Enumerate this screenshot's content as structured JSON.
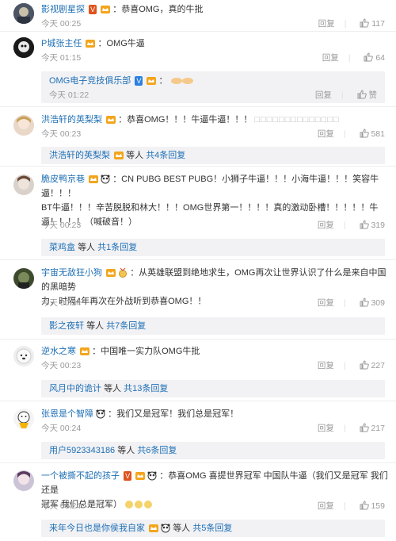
{
  "comments": [
    {
      "user": "影视剧星探",
      "text": "：恭喜OMG，真的牛批",
      "time": "今天 00:25",
      "reply_label": "回复",
      "likes": "117"
    },
    {
      "user": "P城张主任",
      "text": "：OMG牛逼",
      "time": "今天 01:15",
      "reply_label": "回复",
      "likes": "64",
      "sub_reply": {
        "user": "OMG电子竞技俱乐部",
        "text": "：",
        "time": "今天 01:22",
        "reply_label": "回复",
        "like_label": "赞"
      }
    },
    {
      "user": "洪浩轩的英梨梨",
      "text": "：恭喜OMG！！！牛逼牛逼！！！",
      "time": "今天 00:23",
      "reply_label": "回复",
      "likes": "581",
      "summary_user": "洪浩轩的英梨梨",
      "summary_mid": "等人",
      "summary_count": "共4条回复"
    },
    {
      "user": "脆皮鸭京巷",
      "text_lines": [
        "：CN PUBG BEST PUBG！小狮子牛逼！！！小海牛逼！！！笑容牛逼！！！",
        "BT牛逼！！！辛苦脱脱和林大！！！OMG世界第一！！！！真的激动卧槽！！！！！牛",
        "逼！！！！（喊破音！）"
      ],
      "time": "今天 00:23",
      "reply_label": "回复",
      "likes": "319",
      "summary_user": "菜鸡盒",
      "summary_mid": "等人",
      "summary_count": "共1条回复"
    },
    {
      "user": "宇宙无敌狂小狗",
      "text_lines": [
        "：从英雄联盟到绝地求生，OMG再次让世界认识了什么是来自中国的黑暗势",
        "力，时隔4年再次在外战听到恭喜OMG！！"
      ],
      "time": "今天 00:24",
      "reply_label": "回复",
      "likes": "309",
      "summary_user": "影之夜轩",
      "summary_mid": "等人",
      "summary_count": "共7条回复"
    },
    {
      "user": "逆水之寒",
      "text": "：中国唯一实力队OMG牛批",
      "time": "今天 00:23",
      "reply_label": "回复",
      "likes": "227",
      "summary_user": "风月中的诡计",
      "summary_mid": "等人",
      "summary_count": "共13条回复"
    },
    {
      "user": "张恩是个智障",
      "text": "：我们又是冠军！我们总是冠军！",
      "time": "今天 00:24",
      "reply_label": "回复",
      "likes": "217",
      "summary_user": "用户5923343186",
      "summary_mid": "等人",
      "summary_count": "共6条回复"
    },
    {
      "user": "一个被撕不起的孩子",
      "text_lines": [
        "：恭喜OMG 喜提世界冠军  中国队牛逼（我们又是冠军 我们还是",
        "冠军 我们总是冠军）"
      ],
      "time": "今天 00:24",
      "reply_label": "回复",
      "likes": "159",
      "summary_user": "来年今日也是你侯我自家",
      "summary_mid": "等人",
      "summary_count": "共5条回复"
    }
  ],
  "colors": {
    "link": "#1e6fb4",
    "muted": "#9a9a9a",
    "reply_bg": "#f2f2f5"
  }
}
